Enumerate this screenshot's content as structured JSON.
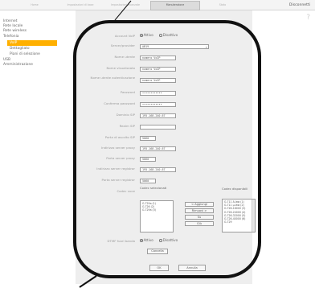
{
  "tabs": [
    {
      "label": "Home"
    },
    {
      "label": "Impostazioni di base"
    },
    {
      "label": "Impostazioni avanzate"
    },
    {
      "label": "Manutenzione"
    },
    {
      "label": "Stato"
    }
  ],
  "top_right_link": "Disconnetti",
  "sidebar": {
    "items": [
      {
        "label": "Internet"
      },
      {
        "label": "Rete locale"
      },
      {
        "label": "Rete wireless"
      },
      {
        "label": "Telefonia"
      },
      {
        "label": "VoIP"
      },
      {
        "label": "Dettagliato"
      },
      {
        "label": "Piani di selezione"
      },
      {
        "label": "USB"
      },
      {
        "label": "Amministrazione"
      }
    ]
  },
  "form": {
    "account_voip": {
      "label": "Account VoIP",
      "on": "Attivo",
      "off": "Disattivo"
    },
    "server_provider": {
      "label": "Server/provider",
      "value": "AB19"
    },
    "nome_utente": {
      "label": "Nome utente",
      "value": "numero VoIP"
    },
    "nome_visualizzato": {
      "label": "Nome visualizzato",
      "value": "numero VoIP"
    },
    "nome_utente_autenticazione": {
      "label": "Nome utente autenticazione",
      "value": "numero VoIP"
    },
    "password": {
      "label": "Password",
      "value": "••••••••••••"
    },
    "conferma_password": {
      "label": "Conferma password",
      "value": "••••••••••••"
    },
    "dominio_sip": {
      "label": "Dominio SIP",
      "value": "195.168.240.67"
    },
    "realm_sip": {
      "label": "Realm SIP",
      "value": ""
    },
    "porta_locale_sip": {
      "label": "Porta di ascolto SIP",
      "value": "5060"
    },
    "indirizzo_server_proxy": {
      "label": "Indirizzo server proxy",
      "value": "195.168.240.67"
    },
    "porta_server_proxy": {
      "label": "Porta server proxy",
      "value": "5060"
    },
    "indirizzo_server_registrar": {
      "label": "Indirizzo server registrar",
      "value": "195.168.240.67"
    },
    "porta_server_registrar": {
      "label": "Porta server registrar",
      "value": "5060"
    },
    "codec_voce": {
      "label": "Codec voce",
      "selected_title": "Codec selezionati",
      "available_title": "Codec disponibili",
      "selected": [
        "G.729a (1)",
        "G.726 (2)",
        "G.729a (3)"
      ],
      "available": [
        "G.711 A-law (1)",
        "G.711 µ-law (2)",
        "G.726-16000 (3)",
        "G.726-24000 (4)",
        "G.726-32000 (5)",
        "G.726-40000 (6)",
        "G.729"
      ],
      "buttons": {
        "add": "< Aggiungi",
        "remove": "Rimuovi >",
        "up": "Su",
        "down": "Giù"
      }
    },
    "dtmf": {
      "label": "DTMF fuori banda",
      "on": "Attivo",
      "off": "Disattivo"
    },
    "cancel_label": "Cancella",
    "ok_label": "OK",
    "annulla_label": "Annulla"
  }
}
